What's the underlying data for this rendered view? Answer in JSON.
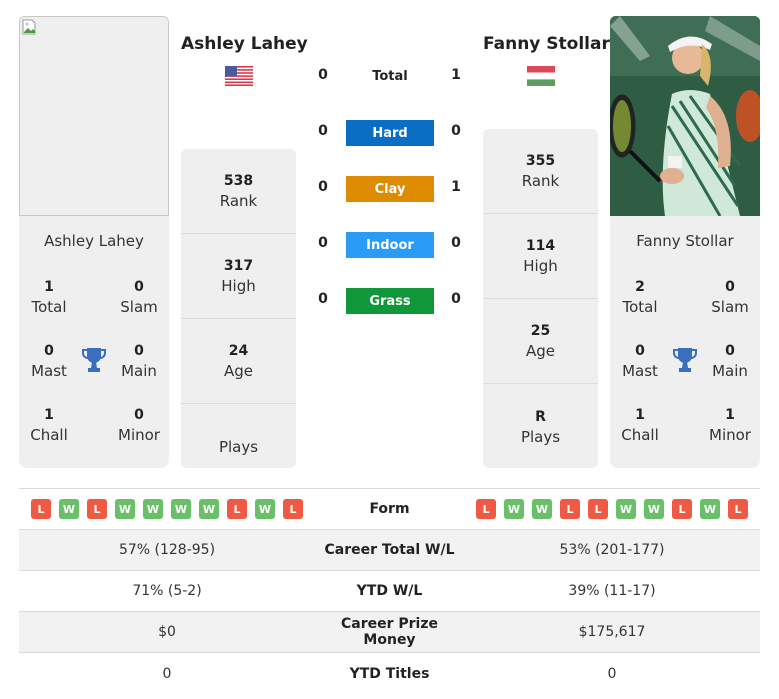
{
  "player_left": {
    "name": "Ashley Lahey",
    "country_flag": "usa-flag",
    "photo": "broken-image",
    "stats": [
      {
        "value": "538",
        "label": "Rank"
      },
      {
        "value": "317",
        "label": "High"
      },
      {
        "value": "24",
        "label": "Age"
      },
      {
        "value": "",
        "label": "Plays"
      }
    ],
    "titles": {
      "name": "Ashley Lahey",
      "total": {
        "value": "1",
        "label": "Total"
      },
      "slam": {
        "value": "0",
        "label": "Slam"
      },
      "mast": {
        "value": "0",
        "label": "Mast"
      },
      "main": {
        "value": "0",
        "label": "Main"
      },
      "chall": {
        "value": "1",
        "label": "Chall"
      },
      "minor": {
        "value": "0",
        "label": "Minor"
      }
    }
  },
  "player_right": {
    "name": "Fanny Stollar",
    "country_flag": "hungary-flag",
    "photo": "player-photo",
    "stats": [
      {
        "value": "355",
        "label": "Rank"
      },
      {
        "value": "114",
        "label": "High"
      },
      {
        "value": "25",
        "label": "Age"
      },
      {
        "value": "R",
        "label": "Plays"
      }
    ],
    "titles": {
      "name": "Fanny Stollar",
      "total": {
        "value": "2",
        "label": "Total"
      },
      "slam": {
        "value": "0",
        "label": "Slam"
      },
      "mast": {
        "value": "0",
        "label": "Mast"
      },
      "main": {
        "value": "0",
        "label": "Main"
      },
      "chall": {
        "value": "1",
        "label": "Chall"
      },
      "minor": {
        "value": "1",
        "label": "Minor"
      }
    }
  },
  "h2h": {
    "total": {
      "label": "Total",
      "left": "0",
      "right": "1"
    },
    "surfaces": [
      {
        "label": "Hard",
        "left": "0",
        "right": "0",
        "color": "#0a6ec4"
      },
      {
        "label": "Clay",
        "left": "0",
        "right": "1",
        "color": "#dd8b00"
      },
      {
        "label": "Indoor",
        "left": "0",
        "right": "0",
        "color": "#2b9cf5"
      },
      {
        "label": "Grass",
        "left": "0",
        "right": "0",
        "color": "#0f973a"
      }
    ]
  },
  "comparison": {
    "form": {
      "label": "Form",
      "left": [
        "L",
        "W",
        "L",
        "W",
        "W",
        "W",
        "W",
        "L",
        "W",
        "L"
      ],
      "right": [
        "L",
        "W",
        "W",
        "L",
        "L",
        "W",
        "W",
        "L",
        "W",
        "L"
      ]
    },
    "rows": [
      {
        "label": "Career Total W/L",
        "left": "57% (128-95)",
        "right": "53% (201-177)"
      },
      {
        "label": "YTD W/L",
        "left": "71% (5-2)",
        "right": "39% (11-17)"
      },
      {
        "label": "Career Prize Money",
        "left": "$0",
        "right": "$175,617"
      },
      {
        "label": "YTD Titles",
        "left": "0",
        "right": "0"
      }
    ]
  },
  "colors": {
    "win": "#6abf69",
    "loss": "#ee5a44",
    "trophy": "#3a6fbd"
  }
}
